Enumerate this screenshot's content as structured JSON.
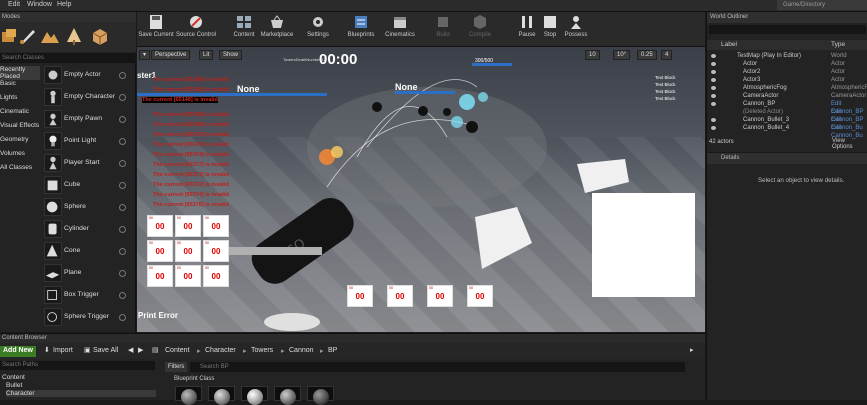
{
  "menu": [
    "Edit",
    "Window",
    "Help"
  ],
  "project_badge": "Game/Directory",
  "modes": {
    "tab": "Modes",
    "search_placeholder": "Search Classes",
    "categories": [
      "Recently Placed",
      "Basic",
      "Lights",
      "Cinematic",
      "Visual Effects",
      "Geometry",
      "Volumes",
      "All Classes"
    ],
    "items": [
      "Empty Actor",
      "Empty Character",
      "Empty Pawn",
      "Point Light",
      "Player Start",
      "Cube",
      "Sphere",
      "Cylinder",
      "Cone",
      "Plane",
      "Box Trigger",
      "Sphere Trigger"
    ]
  },
  "toolbar": {
    "items": [
      "Save Current",
      "Source Control",
      "Content",
      "Marketplace",
      "Settings",
      "Blueprints",
      "Cinematics",
      "Build",
      "Compile",
      "Pause",
      "Stop",
      "Possess"
    ]
  },
  "viewport": {
    "perspective": "Perspective",
    "lit": "Lit",
    "show": "Show",
    "timer": "00:00",
    "stat_caption": "TowersDeathNumber 12",
    "none_left": "None",
    "none_right": "None",
    "ratio": "300/500",
    "ster": "ster1",
    "print_error": "Print Error",
    "error_messages": [
      "The current [65168] is invalid",
      "The current [65148] is invalid",
      "The current [65146] is invalid",
      "The current [65358] is invalid",
      "The current [65368] is invalid",
      "The current [65376] is invalid",
      "The current [65370] is invalid",
      "The current [65374] is invalid",
      "The current [65377] is invalid",
      "The current [65373] is invalid",
      "The current [65372] is invalid",
      "The current [65374] is invalid",
      "The current [65378] is invalid"
    ],
    "cell_value": "00",
    "cell_small": "00",
    "right_text": [
      "Text Block",
      "Text Block",
      "Text Block",
      "Text Block"
    ],
    "grid_values": [
      "10",
      "10°",
      "0.25",
      "4"
    ]
  },
  "outliner": {
    "tab": "World Outliner",
    "col_label": "Label",
    "col_type": "Type",
    "rows": [
      {
        "label": "TestMap (Play In Editor)",
        "type": "World",
        "link": false
      },
      {
        "label": "Actor",
        "type": "Actor",
        "link": false
      },
      {
        "label": "Actor2",
        "type": "Actor",
        "link": false
      },
      {
        "label": "Actor3",
        "type": "Actor",
        "link": false
      },
      {
        "label": "AtmosphericFog",
        "type": "AtmosphericFog",
        "link": false
      },
      {
        "label": "CameraActor",
        "type": "CameraActor",
        "link": false
      },
      {
        "label": "Cannon_BP",
        "type": "Edit Cannon_BP",
        "link": true
      },
      {
        "label": "(Deleted Actor)",
        "type": "Edit Cannon_BP",
        "link": true
      },
      {
        "label": "Cannon_Bullet_3",
        "type": "Edit Cannon_Bu",
        "link": true
      },
      {
        "label": "Cannon_Bullet_4",
        "type": "Edit Cannon_Bu",
        "link": true
      }
    ],
    "count": "42 actors",
    "view_options": "View Options"
  },
  "details": {
    "tab": "Details",
    "message": "Select an object to view details."
  },
  "content_browser": {
    "tab": "Content Browser",
    "add_new": "Add New",
    "import": "Import",
    "save_all": "Save All",
    "breadcrumb": [
      "Content",
      "Character",
      "Towers",
      "Cannon",
      "BP"
    ],
    "paths_placeholder": "Search Paths",
    "tree": [
      "Content",
      "Bullet",
      "Character"
    ],
    "filters": "Filters",
    "search_placeholder": "Search BP",
    "class_label": "Blueprint Class"
  },
  "colors": {
    "accent_green": "#3a7d25",
    "link_blue": "#5a8fd6",
    "error_red": "#c0201a",
    "health_blue": "#2b6fc6"
  }
}
